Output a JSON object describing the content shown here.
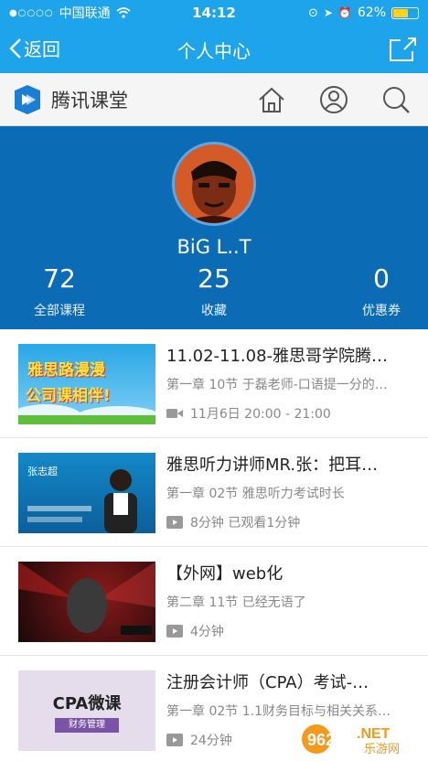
{
  "status_bar": {
    "carrier": "中国联通",
    "time": "14:12",
    "battery": "62%",
    "battery_level": 0.62
  },
  "nav": {
    "back_label": "返回",
    "title": "个人中心"
  },
  "brand": {
    "name": "腾讯课堂"
  },
  "profile": {
    "username": "BiG L..T",
    "stats": [
      {
        "value": "72",
        "label": "全部课程"
      },
      {
        "value": "25",
        "label": "收藏"
      },
      {
        "value": "0",
        "label": "优惠券"
      }
    ]
  },
  "courses": [
    {
      "title": "11.02-11.08-雅思哥学院腾…",
      "subtitle": "第一章 10节 于磊老师-口语提一分的…",
      "meta": "11月6日 20:00 - 21:00",
      "meta_icon": "video-camera-icon",
      "thumb_text1": "雅思路漫漫",
      "thumb_text2": "公司课相伴!"
    },
    {
      "title": "雅思听力讲师MR.张：把耳…",
      "subtitle": "第一章 02节 雅思听力考试时长",
      "meta": "8分钟 已观看1分钟",
      "meta_icon": "play-icon",
      "thumb_text1": "张志超",
      "thumb_text2": ""
    },
    {
      "title": "【外网】web化",
      "subtitle": "第二章 11节 已经无语了",
      "meta": "4分钟",
      "meta_icon": "play-icon",
      "thumb_text1": "",
      "thumb_text2": ""
    },
    {
      "title": "注册会计师（CPA）考试-…",
      "subtitle": "第一章 02节 1.1财务目标与相关关系…",
      "meta": "24分钟",
      "meta_icon": "play-icon",
      "thumb_text1": "CPA微课",
      "thumb_text2": "财务管理"
    }
  ],
  "watermark": {
    "text": "962",
    "net": ".NET",
    "cn": "乐游网"
  },
  "colors": {
    "primary": "#1ea4ea",
    "profile_bg": "#0c6bb5"
  }
}
